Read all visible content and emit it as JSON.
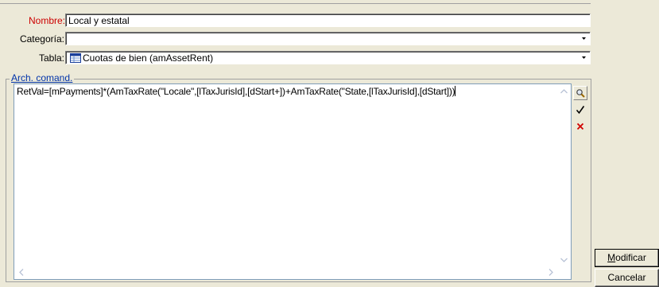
{
  "form": {
    "nombre_label": "Nombre:",
    "nombre_value": "Local y estatal",
    "categoria_label": "Categoría:",
    "categoria_value": "",
    "tabla_label": "Tabla:",
    "tabla_value": "Cuotas de bien (amAssetRent)",
    "tabla_icon": "table-icon"
  },
  "script": {
    "group_title": "Arch. comand.",
    "code": "RetVal=[mPayments]*(AmTaxRate(\"Locale\",[lTaxJurisId],[dStart+])+AmTaxRate(\"State,[lTaxJurisId],[dStart]))"
  },
  "tools": {
    "search_icon": "magnifier-icon",
    "validate_icon": "checkmark-icon",
    "delete_icon": "red-x-icon"
  },
  "buttons": {
    "modify_first": "M",
    "modify_rest": "odificar",
    "cancel": "Cancelar"
  },
  "colors": {
    "accent_label": "#cc0000",
    "group_title": "#0033aa",
    "background": "#ece9d8"
  }
}
